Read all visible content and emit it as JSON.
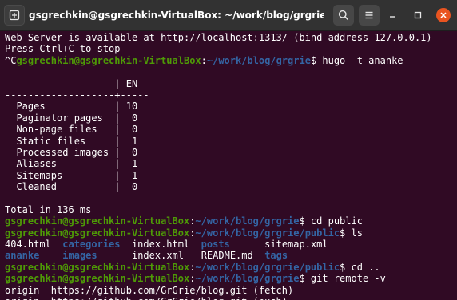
{
  "window": {
    "title": "gsgrechkin@gsgrechkin-VirtualBox: ~/work/blog/grgrie/public"
  },
  "colors": {
    "background": "#300a24",
    "titlebar": "#323232",
    "prompt_user": "#4e9a06",
    "prompt_path": "#3465a4",
    "close_button": "#e95420"
  },
  "icons": {
    "new_tab": "new-tab-icon",
    "search": "search-icon",
    "menu": "hamburger-menu-icon",
    "minimize": "minimize-icon",
    "maximize": "maximize-icon",
    "close": "close-icon"
  },
  "terminal": {
    "lines": [
      {
        "text": "Web Server is available at http://localhost:1313/ (bind address 127.0.0.1)"
      },
      {
        "text": "Press Ctrl+C to stop"
      },
      {
        "prefix": "^C",
        "user": "gsgrechkin@gsgrechkin-VirtualBox",
        "path": "~/work/blog/grgrie",
        "cmd": " hugo -t ananke"
      },
      {
        "text": ""
      },
      {
        "text": "                   | EN"
      },
      {
        "text": "-------------------+-----"
      },
      {
        "text": "  Pages            | 10"
      },
      {
        "text": "  Paginator pages  |  0"
      },
      {
        "text": "  Non-page files   |  0"
      },
      {
        "text": "  Static files     |  1"
      },
      {
        "text": "  Processed images |  0"
      },
      {
        "text": "  Aliases          |  1"
      },
      {
        "text": "  Sitemaps         |  1"
      },
      {
        "text": "  Cleaned          |  0"
      },
      {
        "text": ""
      },
      {
        "text": "Total in 136 ms"
      },
      {
        "user": "gsgrechkin@gsgrechkin-VirtualBox",
        "path": "~/work/blog/grgrie",
        "cmd": " cd public"
      },
      {
        "user": "gsgrechkin@gsgrechkin-VirtualBox",
        "path": "~/work/blog/grgrie/public",
        "cmd": " ls"
      },
      {
        "ls": [
          {
            "name": "404.html",
            "type": "file",
            "pad": "  "
          },
          {
            "name": "categories",
            "type": "dir",
            "pad": "  "
          },
          {
            "name": "index.html",
            "type": "file",
            "pad": "  "
          },
          {
            "name": "posts",
            "type": "dir",
            "pad": "      "
          },
          {
            "name": "sitemap.xml",
            "type": "file",
            "pad": ""
          }
        ]
      },
      {
        "ls": [
          {
            "name": "ananke",
            "type": "dir",
            "pad": "    "
          },
          {
            "name": "images",
            "type": "dir",
            "pad": "      "
          },
          {
            "name": "index.xml",
            "type": "file",
            "pad": "   "
          },
          {
            "name": "README.md",
            "type": "file",
            "pad": "  "
          },
          {
            "name": "tags",
            "type": "dir",
            "pad": ""
          }
        ]
      },
      {
        "user": "gsgrechkin@gsgrechkin-VirtualBox",
        "path": "~/work/blog/grgrie/public",
        "cmd": " cd .."
      },
      {
        "user": "gsgrechkin@gsgrechkin-VirtualBox",
        "path": "~/work/blog/grgrie",
        "cmd": " git remote -v"
      },
      {
        "text": "origin  https://github.com/GrGrie/blog.git (fetch)"
      },
      {
        "text": "origin  https://github.com/GrGrie/blog.git (push)"
      }
    ]
  }
}
